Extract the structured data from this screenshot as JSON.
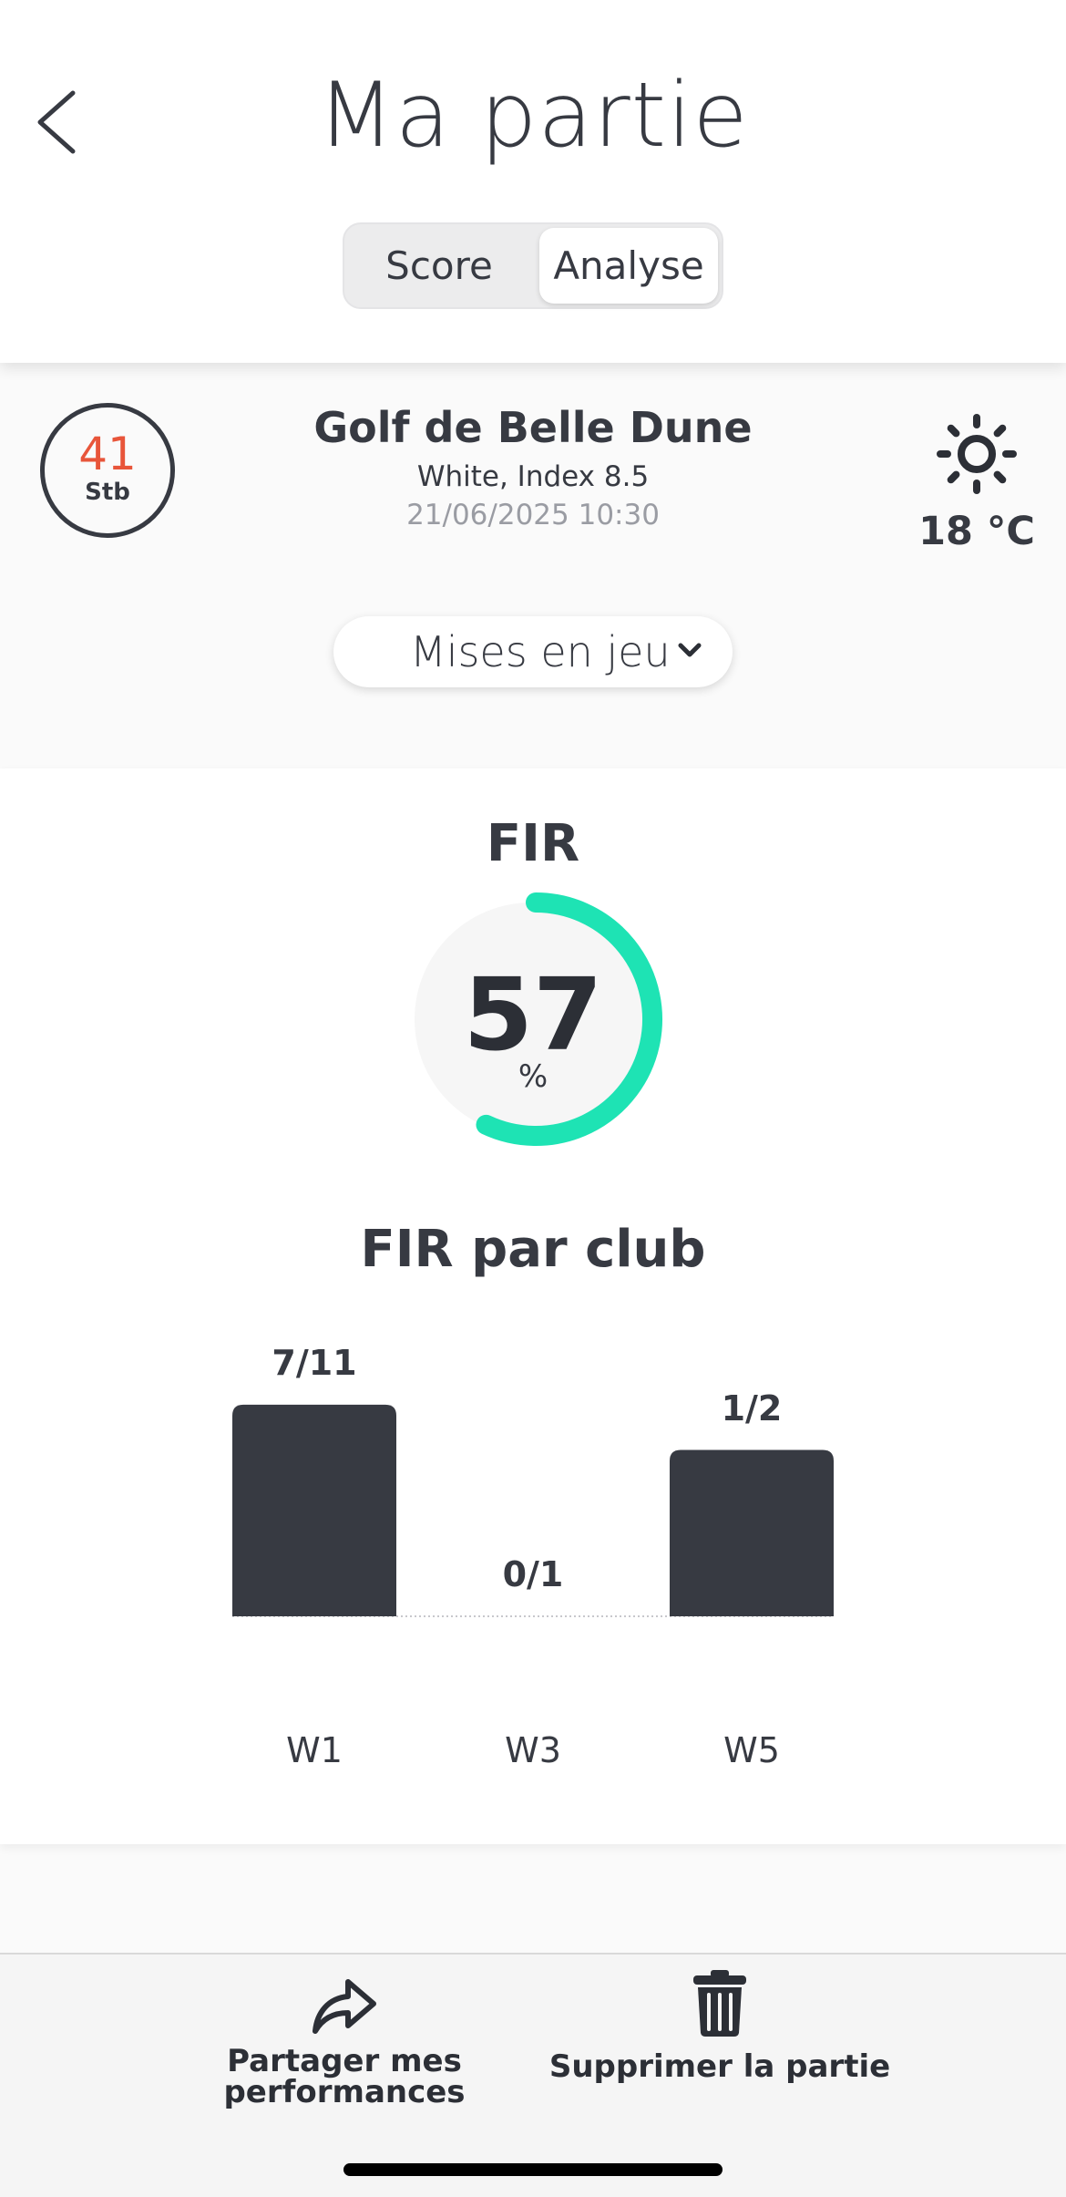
{
  "header": {
    "title": "Ma partie",
    "tabs": [
      {
        "label": "Score",
        "selected": false
      },
      {
        "label": "Analyse",
        "selected": true
      }
    ]
  },
  "round": {
    "score_value": "41",
    "score_unit": "Stb",
    "course_name": "Golf de Belle Dune",
    "tee_index": "White, Index 8.5",
    "datetime": "21/06/2025 10:30",
    "weather_icon": "sun-icon",
    "temperature": "18 °C"
  },
  "filter": {
    "selected": "Mises en jeu"
  },
  "fir": {
    "title": "FIR",
    "percent": 57,
    "percent_label": "57",
    "unit": "%"
  },
  "chart_data": {
    "type": "bar",
    "title": "FIR par club",
    "categories": [
      "W1",
      "W3",
      "W5"
    ],
    "values": [
      0.636,
      0,
      0.5
    ],
    "value_labels": [
      "7/11",
      "0/1",
      "1/2"
    ],
    "ylim": [
      0,
      1
    ],
    "grid": false
  },
  "actions": {
    "share_label_line1": "Partager mes",
    "share_label_line2": "performances",
    "delete_label": "Supprimer la partie"
  },
  "colors": {
    "accent": "#1ee3b4",
    "bar": "#373a42",
    "score": "#e8553a",
    "text": "#373a42"
  }
}
